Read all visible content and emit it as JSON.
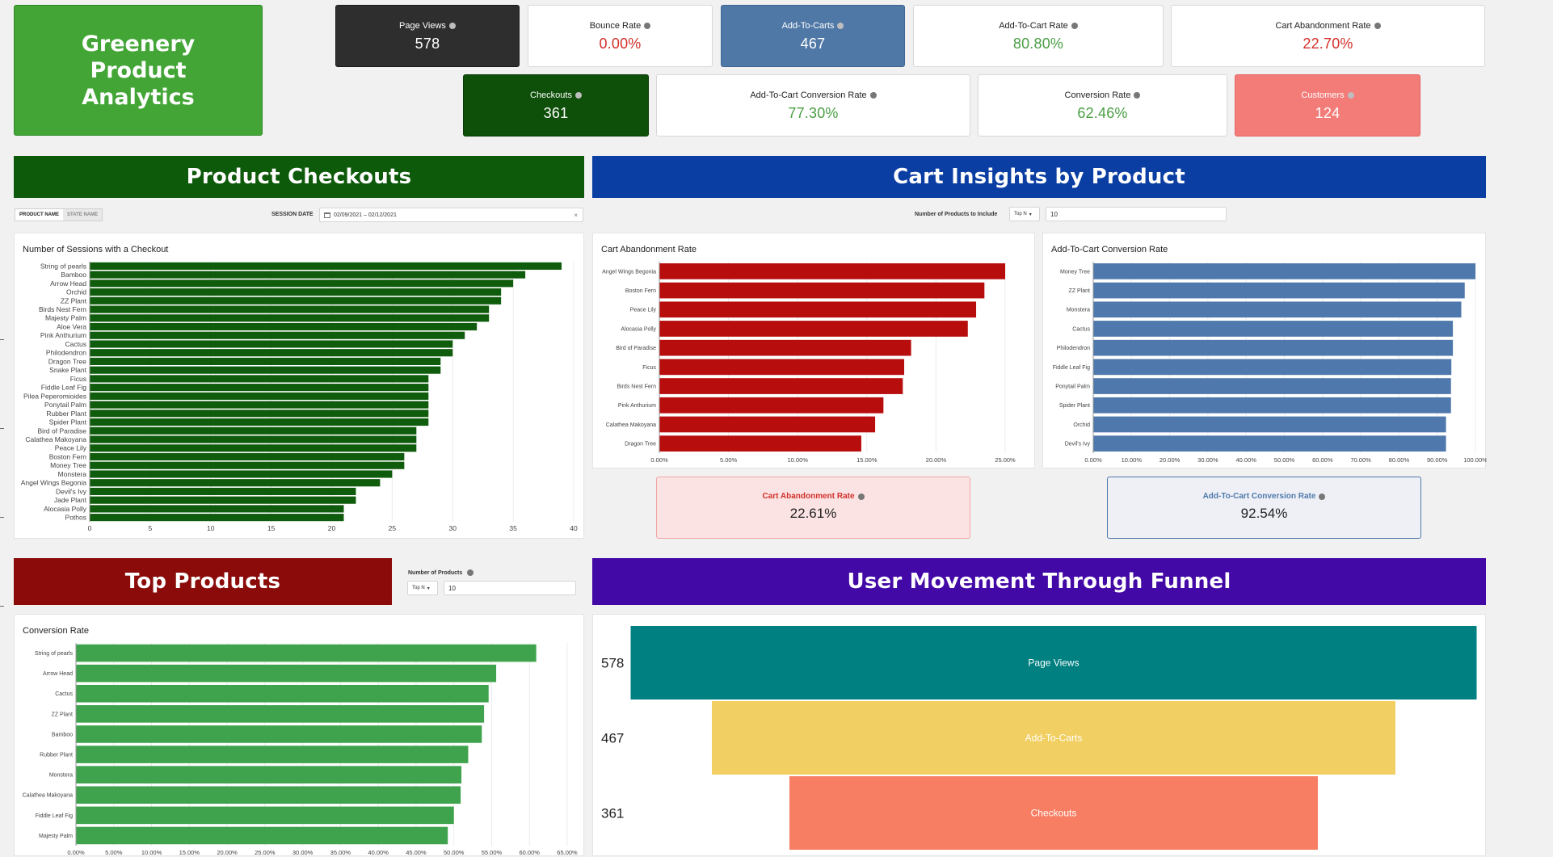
{
  "header": {
    "title": "Greenery Product Analytics"
  },
  "kpis": {
    "page_views": {
      "label": "Page Views",
      "value": "578"
    },
    "bounce_rate": {
      "label": "Bounce Rate",
      "value": "0.00%"
    },
    "add_to_carts": {
      "label": "Add-To-Carts",
      "value": "467"
    },
    "add_to_cart_rate": {
      "label": "Add-To-Cart Rate",
      "value": "80.80%"
    },
    "cart_abandonment_rate": {
      "label": "Cart Abandonment Rate",
      "value": "22.70%"
    },
    "checkouts": {
      "label": "Checkouts",
      "value": "361"
    },
    "add_to_cart_conversion_rate": {
      "label": "Add-To-Cart Conversion Rate",
      "value": "77.30%"
    },
    "conversion_rate": {
      "label": "Conversion Rate",
      "value": "62.46%"
    },
    "customers": {
      "label": "Customers",
      "value": "124"
    }
  },
  "sections": {
    "product_checkouts": "Product Checkouts",
    "cart_insights": "Cart Insights by Product",
    "top_products": "Top Products",
    "funnel": "User Movement Through Funnel"
  },
  "controls": {
    "toggle_product_name": "PRODUCT NAME",
    "toggle_state_name": "STATE NAME",
    "session_date_label": "SESSION DATE",
    "session_date_value": "02/09/2021 – 02/12/2021",
    "clear_symbol": "×",
    "num_products_include_label": "Number of Products to Include",
    "topn_label": "Top N",
    "topn_value": "10",
    "num_products_label": "Number of Products",
    "topn2_label": "Top N",
    "topn2_value": "10"
  },
  "summaries": {
    "cart_abandonment": {
      "label": "Cart Abandonment Rate",
      "value": "22.61%"
    },
    "add_to_cart_conversion": {
      "label": "Add-To-Cart Conversion Rate",
      "value": "92.54%"
    }
  },
  "colors": {
    "title_green": "#42a536",
    "dark_green": "#0e4f09",
    "checkout_bar": "#105c0d",
    "cart_banner_blue": "#0b3ea3",
    "top_banner_red": "#8b0b0b",
    "funnel_banner_purple": "#4309a7",
    "abandon_bar": "#b80d0d",
    "conversion_bar": "#4f79ac",
    "top_bar": "#3fa34d",
    "funnel_teal": "#008080",
    "funnel_yellow": "#f1cf63",
    "funnel_coral": "#f77e63"
  },
  "chart_data": [
    {
      "id": "checkouts",
      "type": "bar",
      "orientation": "horizontal",
      "title": "Number of Sessions with a Checkout",
      "categories": [
        "String of pearls",
        "Bamboo",
        "Arrow Head",
        "Orchid",
        "ZZ Plant",
        "Birds Nest Fern",
        "Majesty Palm",
        "Aloe Vera",
        "Pink Anthurium",
        "Cactus",
        "Philodendron",
        "Dragon Tree",
        "Snake Plant",
        "Ficus",
        "Fiddle Leaf Fig",
        "Pilea Peperomioides",
        "Ponytail Palm",
        "Rubber Plant",
        "Spider Plant",
        "Bird of Paradise",
        "Calathea Makoyana",
        "Peace Lily",
        "Boston Fern",
        "Money Tree",
        "Monstera",
        "Angel Wings Begonia",
        "Devil's Ivy",
        "Jade Plant",
        "Alocasia Polly",
        "Pothos"
      ],
      "values": [
        39,
        36,
        35,
        34,
        34,
        33,
        33,
        32,
        31,
        30,
        30,
        29,
        29,
        28,
        28,
        28,
        28,
        28,
        28,
        27,
        27,
        27,
        26,
        26,
        25,
        24,
        22,
        22,
        21,
        21
      ],
      "xlim": [
        0,
        40
      ],
      "ticks": [
        "0",
        "5",
        "10",
        "15",
        "20",
        "25",
        "30",
        "35",
        "40"
      ]
    },
    {
      "id": "abandonment",
      "type": "bar",
      "orientation": "horizontal",
      "title": "Cart Abandonment Rate",
      "categories": [
        "Angel Wings Begonia",
        "Boston Fern",
        "Peace Lily",
        "Alocasia Polly",
        "Bird of Paradise",
        "Ficus",
        "Birds Nest Fern",
        "Pink Anthurium",
        "Calathea Makoyana",
        "Dragon Tree"
      ],
      "values": [
        25.0,
        23.5,
        22.9,
        22.3,
        18.2,
        17.7,
        17.6,
        16.2,
        15.6,
        14.6
      ],
      "xlim": [
        0,
        25
      ],
      "ticks": [
        "0.00%",
        "5.00%",
        "10.00%",
        "15.00%",
        "20.00%",
        "25.00%"
      ]
    },
    {
      "id": "addtocart",
      "type": "bar",
      "orientation": "horizontal",
      "title": "Add-To-Cart Conversion Rate",
      "categories": [
        "Money Tree",
        "ZZ Plant",
        "Monstera",
        "Cactus",
        "Philodendron",
        "Fiddle Leaf Fig",
        "Ponytail Palm",
        "Spider Plant",
        "Orchid",
        "Devil's Ivy"
      ],
      "values": [
        100,
        97.2,
        96.3,
        94.1,
        94.1,
        93.7,
        93.6,
        93.6,
        92.3,
        92.3
      ],
      "xlim": [
        0,
        100
      ],
      "ticks": [
        "0.00%",
        "10.00%",
        "20.00%",
        "30.00%",
        "40.00%",
        "50.00%",
        "60.00%",
        "70.00%",
        "80.00%",
        "90.00%",
        "100.00%"
      ]
    },
    {
      "id": "topproducts",
      "type": "bar",
      "orientation": "horizontal",
      "title": "Conversion Rate",
      "categories": [
        "String of pearls",
        "Arrow Head",
        "Cactus",
        "ZZ Plant",
        "Bamboo",
        "Rubber Plant",
        "Monstera",
        "Calathea Makoyana",
        "Fiddle Leaf Fig",
        "Majesty Palm"
      ],
      "values": [
        60.9,
        55.6,
        54.6,
        54.0,
        53.7,
        51.9,
        51.0,
        50.9,
        50.0,
        49.2
      ],
      "xlim": [
        0,
        65
      ],
      "ticks": [
        "0.00%",
        "5.00%",
        "10.00%",
        "15.00%",
        "20.00%",
        "25.00%",
        "30.00%",
        "35.00%",
        "40.00%",
        "45.00%",
        "50.00%",
        "55.00%",
        "60.00%",
        "65.00%"
      ]
    },
    {
      "id": "funnel",
      "type": "funnel",
      "stages": [
        {
          "label": "Page Views",
          "value": 578
        },
        {
          "label": "Add-To-Carts",
          "value": 467
        },
        {
          "label": "Checkouts",
          "value": 361
        }
      ]
    }
  ]
}
